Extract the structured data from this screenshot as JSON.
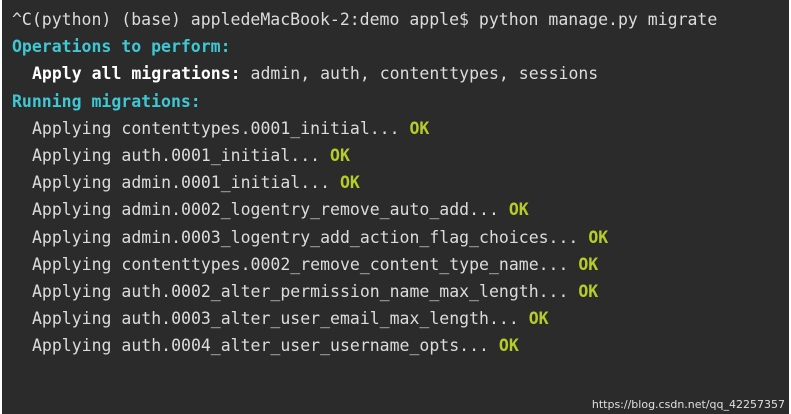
{
  "terminal": {
    "prompt_line": "^C(python) (base) appledeMacBook-2:demo apple$ python manage.py migrate",
    "operations_header": "Operations to perform:",
    "apply_label": "Apply all migrations:",
    "apply_apps": " admin, auth, contenttypes, sessions",
    "running_header": "Running migrations:",
    "migrations": [
      {
        "text": "Applying contenttypes.0001_initial...",
        "status": "OK"
      },
      {
        "text": "Applying auth.0001_initial...",
        "status": "OK"
      },
      {
        "text": "Applying admin.0001_initial...",
        "status": "OK"
      },
      {
        "text": "Applying admin.0002_logentry_remove_auto_add...",
        "status": "OK"
      },
      {
        "text": "Applying admin.0003_logentry_add_action_flag_choices...",
        "status": "OK"
      },
      {
        "text": "Applying contenttypes.0002_remove_content_type_name...",
        "status": "OK"
      },
      {
        "text": "Applying auth.0002_alter_permission_name_max_length...",
        "status": "OK"
      },
      {
        "text": "Applying auth.0003_alter_user_email_max_length...",
        "status": "OK"
      },
      {
        "text": "Applying auth.0004_alter_user_username_opts...",
        "status": "OK"
      }
    ]
  },
  "watermark": "https://blog.csdn.net/qq_42257357",
  "colors": {
    "background": "#2b2b2b",
    "text": "#dcdcdc",
    "header": "#3ec8d4",
    "ok": "#b6cd28"
  }
}
